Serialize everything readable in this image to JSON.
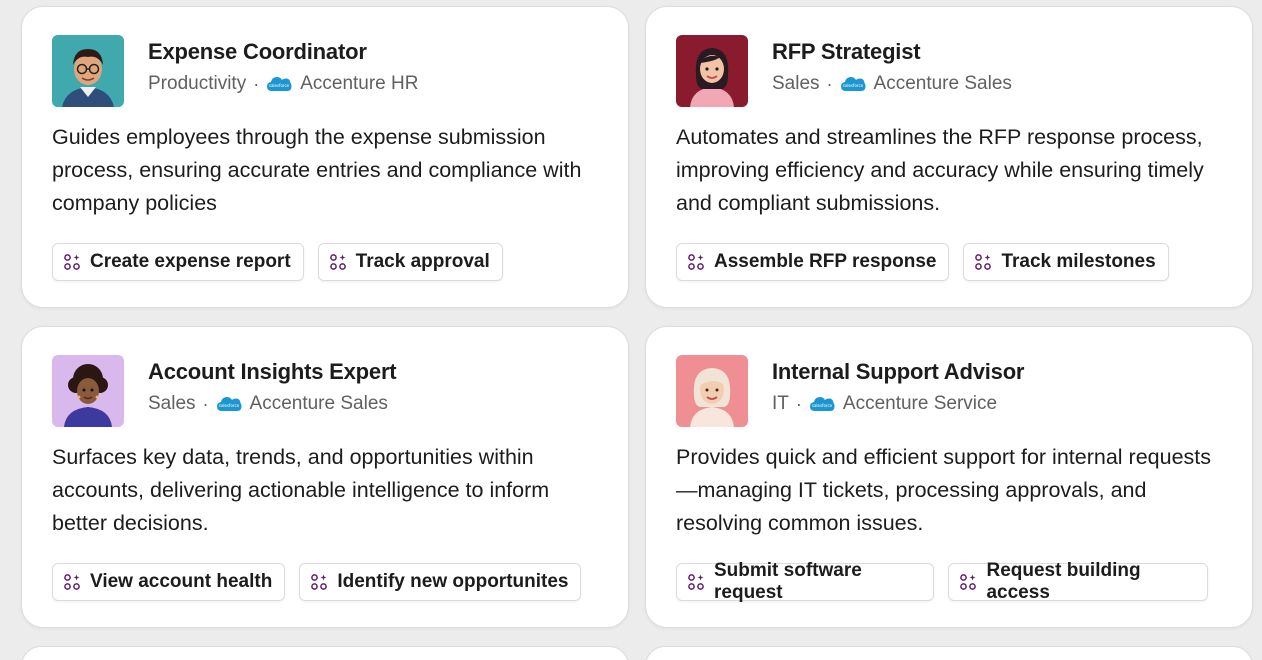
{
  "agents": [
    {
      "name": "Expense Coordinator",
      "category": "Productivity",
      "org": "Accenture HR",
      "description": "Guides employees through the expense submission process, ensuring accurate entries and compliance with company policies",
      "actions": [
        "Create expense report",
        "Track approval"
      ]
    },
    {
      "name": "RFP Strategist",
      "category": "Sales",
      "org": "Accenture Sales",
      "description": "Automates and streamlines the RFP response process, improving efficiency and accuracy while ensuring timely and compliant submissions.",
      "actions": [
        "Assemble RFP response",
        "Track milestones"
      ]
    },
    {
      "name": "Account Insights Expert",
      "category": "Sales",
      "org": "Accenture Sales",
      "description": "Surfaces key data, trends, and opportunities within accounts, delivering actionable intelligence to inform better decisions.",
      "actions": [
        "View account health",
        "Identify new opportunites"
      ]
    },
    {
      "name": "Internal Support Advisor",
      "category": "IT",
      "org": "Accenture Service",
      "description": "Provides quick and efficient support for internal requests—managing IT tickets, processing approvals, and resolving common issues.",
      "actions": [
        "Submit software request",
        "Request building access"
      ]
    }
  ],
  "separator": "·",
  "colors": {
    "salesforce_blue": "#1b96d3",
    "chip_icon_purple": "#611f69",
    "background": "#ececec"
  },
  "icons": {
    "org": "salesforce-cloud-icon",
    "action": "sparkle-grid-icon"
  }
}
